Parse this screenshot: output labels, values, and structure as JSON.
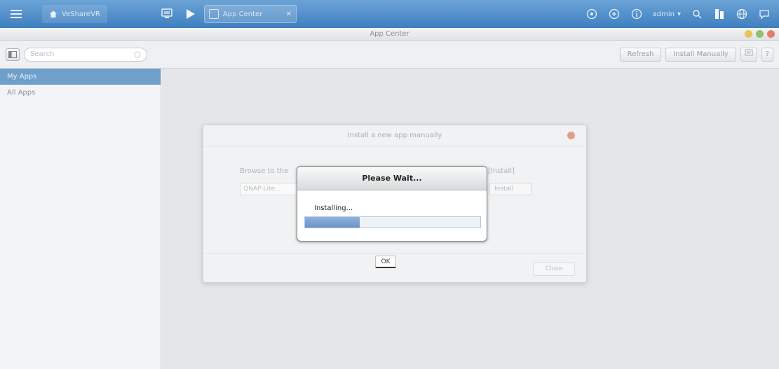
{
  "taskbar": {
    "home_label": "VeShareVR",
    "app_tab_label": "App Center",
    "user_label": "admin"
  },
  "window": {
    "title": "App Center"
  },
  "toolbar": {
    "search_placeholder": "Search",
    "refresh_label": "Refresh",
    "install_manually_label": "Install Manually"
  },
  "sidebar": {
    "items": [
      {
        "label": "My Apps",
        "active": true
      },
      {
        "label": "All Apps",
        "active": false
      }
    ]
  },
  "install_dialog": {
    "title": "Install a new app manually",
    "browse_label": "Browse to the",
    "browse_label_end": "[Install]",
    "file_value": "QNAP-Lite...",
    "install_label": "Install",
    "ok_label": "OK",
    "close_label": "Close"
  },
  "wait_dialog": {
    "title": "Please Wait...",
    "status": "Installing...",
    "progress": 0.31
  },
  "colors": {
    "taskbar": "#4f8ccc",
    "sidebar_active": "#6fa0cc",
    "progress": "#7a9fd2"
  }
}
